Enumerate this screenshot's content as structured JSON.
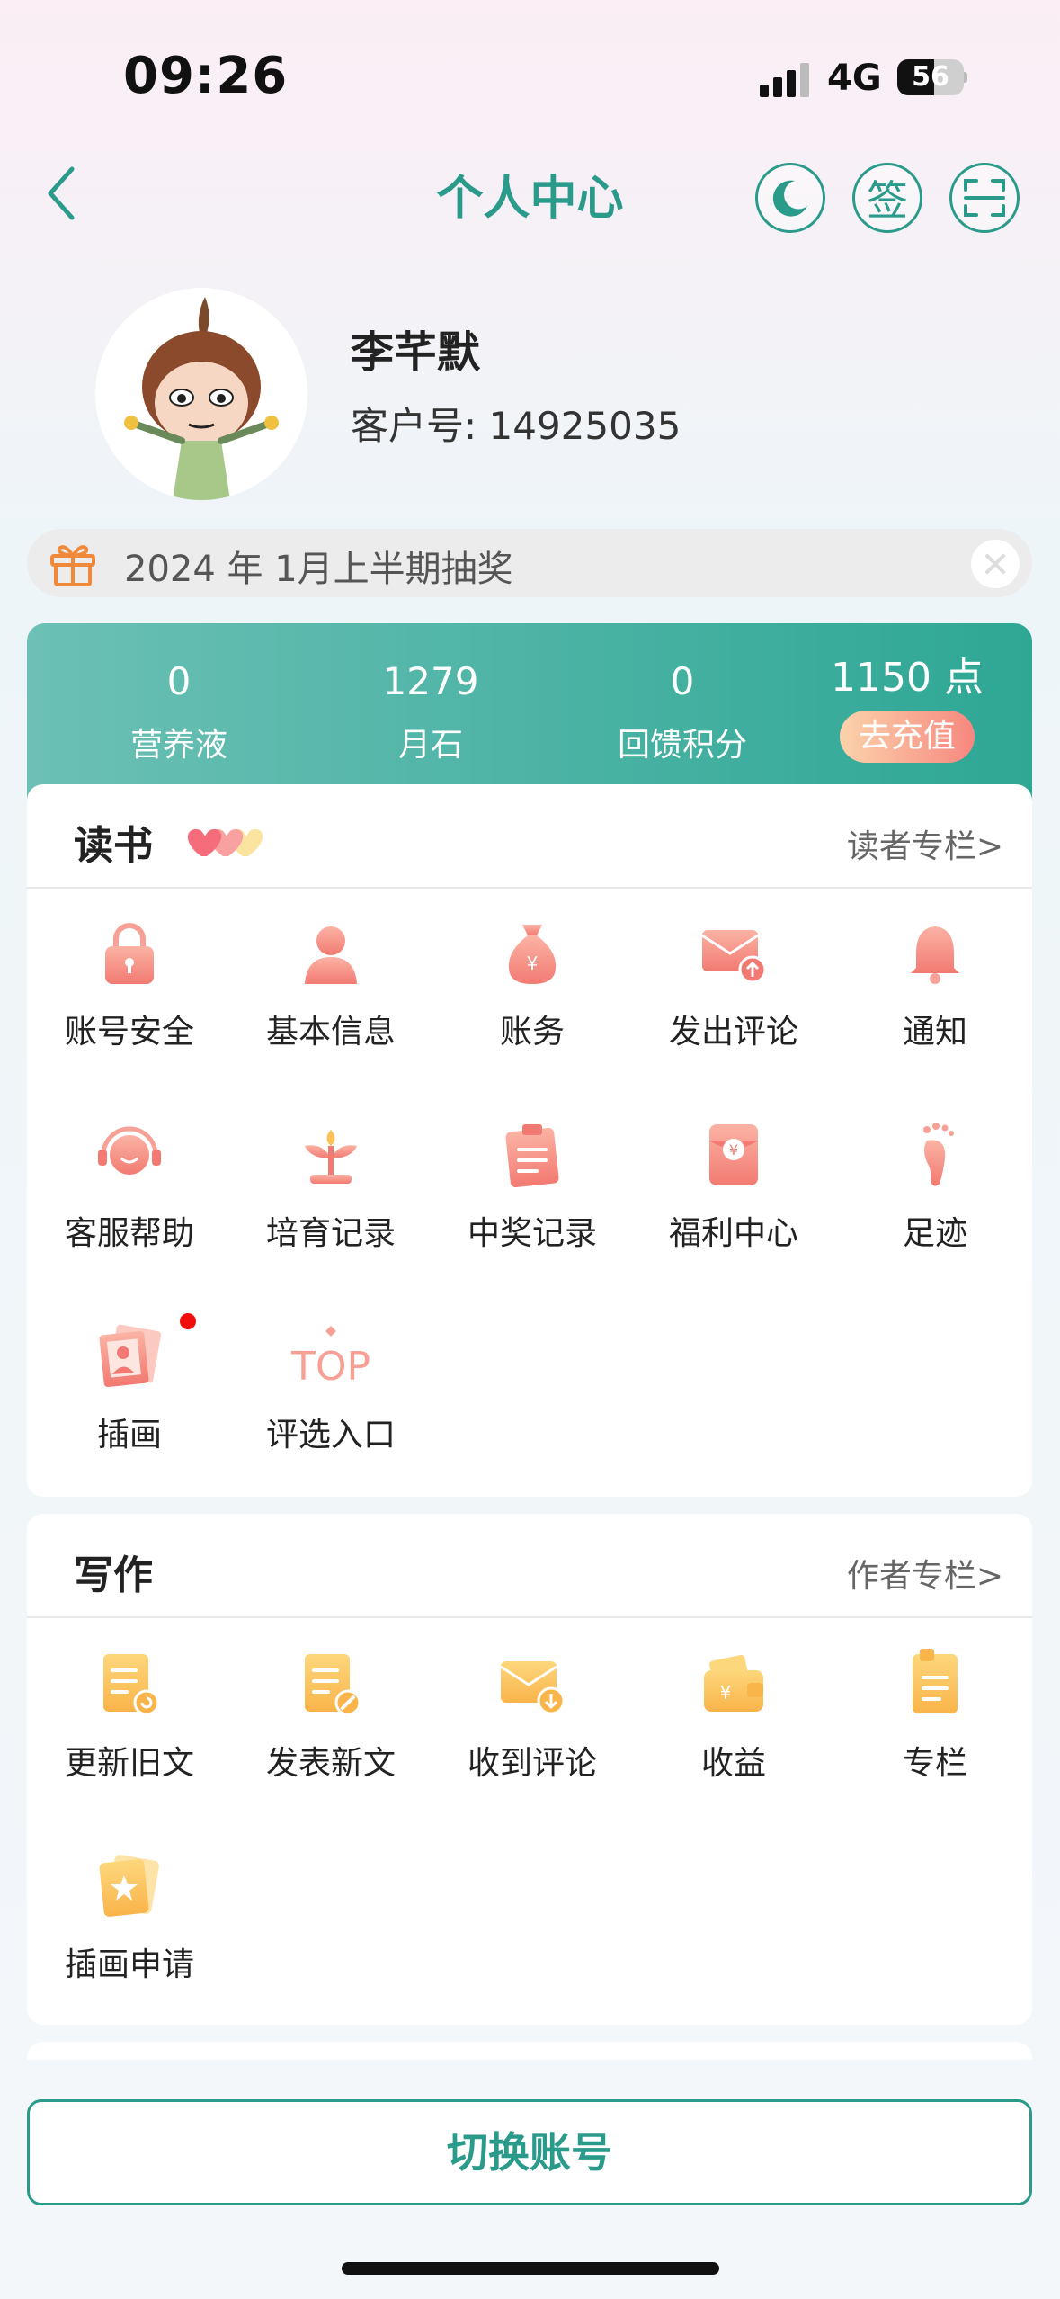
{
  "status_bar": {
    "time": "09:26",
    "network": "4G",
    "battery": "56",
    "battery_level": 0.56
  },
  "header": {
    "title": "个人中心",
    "sign_label": "签",
    "icons": [
      "back-icon",
      "moon-icon",
      "scan-icon"
    ]
  },
  "profile": {
    "name": "李芊默",
    "customer_label": "客户号:",
    "customer_id": "14925035"
  },
  "lottery": {
    "text": "2024 年 1月上半期抽奖",
    "icons": [
      "gift-icon",
      "close-icon"
    ]
  },
  "stats": [
    {
      "value": "0",
      "label": "营养液"
    },
    {
      "value": "1279",
      "label": "月石"
    },
    {
      "value": "0",
      "label": "回馈积分"
    },
    {
      "value": "1150 点",
      "label": "去充值"
    }
  ],
  "reading": {
    "title": "读书",
    "link": "读者专栏>",
    "items": [
      {
        "label": "账号安全",
        "icon": "lock-icon"
      },
      {
        "label": "基本信息",
        "icon": "person-icon"
      },
      {
        "label": "账务",
        "icon": "money-bag-icon"
      },
      {
        "label": "发出评论",
        "icon": "mail-send-icon"
      },
      {
        "label": "通知",
        "icon": "bell-icon"
      },
      {
        "label": "客服帮助",
        "icon": "headset-icon"
      },
      {
        "label": "培育记录",
        "icon": "sprout-icon"
      },
      {
        "label": "中奖记录",
        "icon": "clipboard-icon"
      },
      {
        "label": "福利中心",
        "icon": "red-envelope-icon"
      },
      {
        "label": "足迹",
        "icon": "footprint-icon"
      },
      {
        "label": "插画",
        "icon": "illustration-icon"
      },
      {
        "label": "评选入口",
        "icon": "top-icon",
        "icon_text": "TOP"
      }
    ]
  },
  "writing": {
    "title": "写作",
    "link": "作者专栏>",
    "items": [
      {
        "label": "更新旧文",
        "icon": "doc-refresh-icon"
      },
      {
        "label": "发表新文",
        "icon": "doc-edit-icon"
      },
      {
        "label": "收到评论",
        "icon": "mail-receive-icon"
      },
      {
        "label": "收益",
        "icon": "wallet-icon"
      },
      {
        "label": "专栏",
        "icon": "column-icon"
      },
      {
        "label": "插画申请",
        "icon": "card-star-icon"
      }
    ]
  },
  "footer": {
    "switch_account": "切换账号"
  },
  "colors": {
    "accent": "#2a9a8a",
    "coral": "#f7877f",
    "yellow": "#fbc25a",
    "badge": "#f20d0d"
  }
}
